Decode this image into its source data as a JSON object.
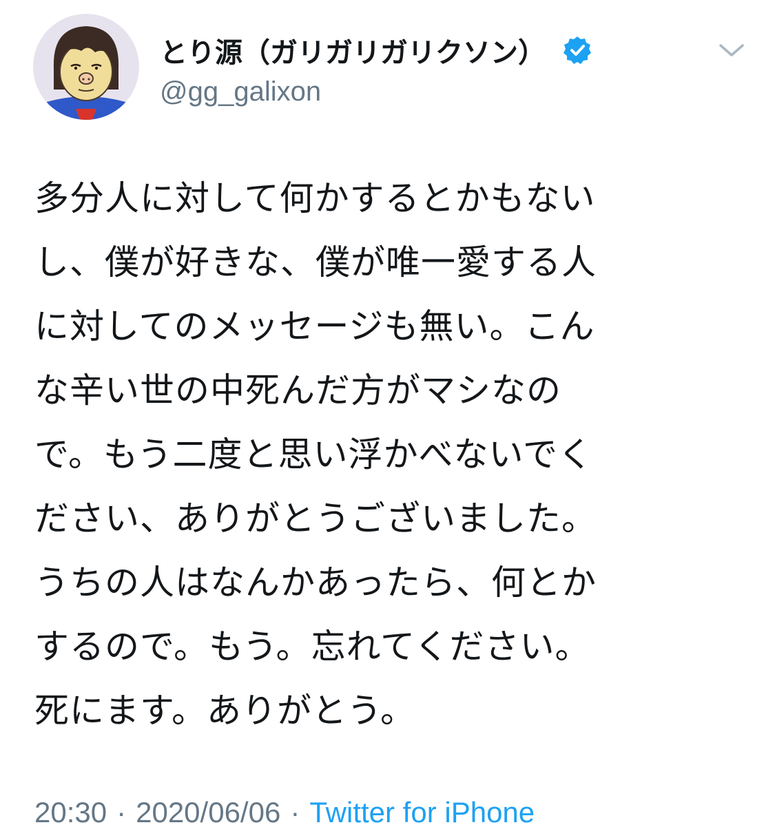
{
  "tweet": {
    "author": {
      "display_name": "とり源（ガリガリガリクソン）",
      "handle": "@gg_galixon",
      "verified": true,
      "avatar_icon": "cartoon-portrait-avatar"
    },
    "menu_icon": "chevron-down-icon",
    "body_lines": [
      "多分人に対して何かするとかもない",
      "し、僕が好きな、僕が唯一愛する人",
      "に対してのメッセージも無い。こん",
      "な辛い世の中死んだ方がマシなの",
      "で。もう二度と思い浮かべないでく",
      "ださい、ありがとうございました。",
      "うちの人はなんかあったら、何とか",
      "するので。もう。忘れてください。",
      "死にます。ありがとう。"
    ],
    "meta": {
      "time": "20:30",
      "separator": "·",
      "date": "2020/06/06",
      "source": "Twitter for iPhone"
    }
  },
  "colors": {
    "text_primary": "#14171a",
    "text_secondary": "#657786",
    "link_blue": "#1da1f2",
    "verified_blue": "#1da1f2",
    "background": "#ffffff"
  }
}
